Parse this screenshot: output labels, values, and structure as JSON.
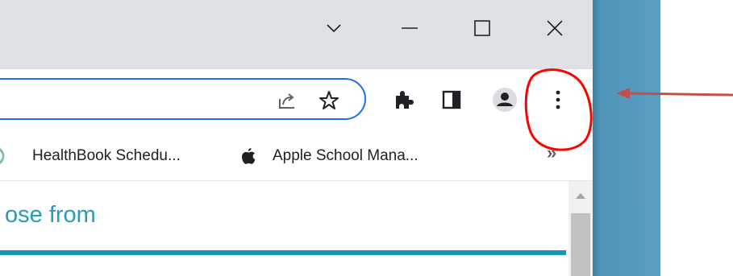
{
  "window": {
    "tab_search_icon": "chevron-down-icon",
    "minimize_icon": "minimize-icon",
    "maximize_icon": "maximize-icon",
    "close_icon": "close-icon"
  },
  "toolbar": {
    "omnibox_icons": [
      "share-icon",
      "star-icon"
    ],
    "icons": [
      "extensions-puzzle-icon",
      "side-panel-icon",
      "profile-avatar-icon",
      "more-vertical-icon"
    ]
  },
  "bookmarks": {
    "items": [
      {
        "label": "HealthBook Schedu...",
        "icon": "healthbook-favicon"
      },
      {
        "label": "Apple School Mana...",
        "icon": "apple-icon"
      }
    ],
    "overflow_label": "»"
  },
  "page": {
    "heading": "ose from"
  },
  "annotations": {
    "circle_color": "#ff0000",
    "arrow_color": "#c0504d"
  },
  "colors": {
    "titlebar": "#dee1e6",
    "omnibox_focus": "#1a73e8",
    "heading_text": "#2a9bb6",
    "heading_rule": "#1597b8",
    "desktop": "#5a9ec2"
  }
}
